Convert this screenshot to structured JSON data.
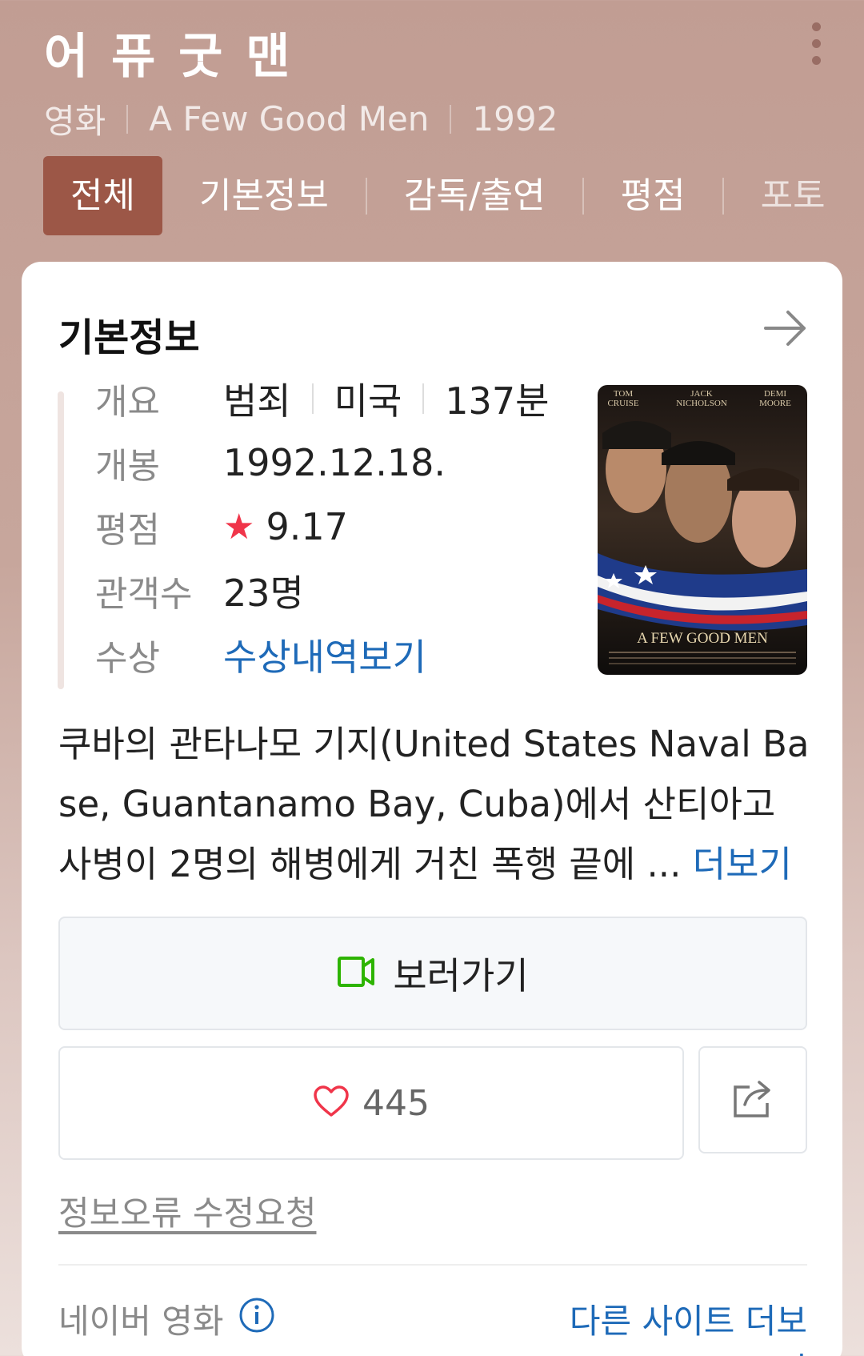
{
  "header": {
    "title": "어 퓨 굿 맨",
    "subtitle": {
      "type": "영화",
      "original_title": "A Few Good Men",
      "year": "1992"
    },
    "tabs": [
      {
        "label": "전체",
        "active": true
      },
      {
        "label": "기본정보"
      },
      {
        "label": "감독/출연"
      },
      {
        "label": "평점"
      },
      {
        "label": "포토"
      }
    ]
  },
  "card": {
    "title": "기본정보",
    "info": {
      "overview_label": "개요",
      "genre": "범죄",
      "country": "미국",
      "runtime": "137분",
      "release_label": "개봉",
      "release_date": "1992.12.18.",
      "rating_label": "평점",
      "rating": "9.17",
      "audience_label": "관객수",
      "audience": "23명",
      "awards_label": "수상",
      "awards_link": "수상내역보기"
    },
    "poster": {
      "credits": [
        "TOM CRUISE",
        "JACK NICHOLSON",
        "DEMI MOORE"
      ],
      "credit_lines": [
        [
          "TOM",
          "CRUISE"
        ],
        [
          "JACK",
          "NICHOLSON"
        ],
        [
          "DEMI",
          "MOORE"
        ]
      ],
      "poster_title": "A FEW GOOD MEN"
    },
    "synopsis": "쿠바의 관타나모 기지(United States Naval Base, Guantanamo Bay, Cuba)에서 산티아고 사병이 2명의 해병에게 거친 폭행 끝에 ... ",
    "synopsis_more": "더보기",
    "watch_label": "보러가기",
    "like_count": "445",
    "report_label": "정보오류 수정요청",
    "source_label": "네이버 영화",
    "other_sites_label": "다른 사이트 더보기"
  },
  "colors": {
    "accent": "#9c5747",
    "link": "#1e6ab8",
    "star": "#f0354a",
    "watch_icon": "#2db400"
  }
}
